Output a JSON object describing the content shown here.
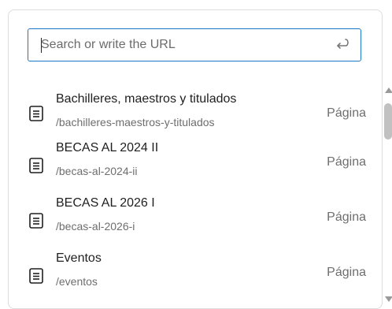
{
  "search": {
    "placeholder": "Search or write the URL",
    "value": ""
  },
  "results": [
    {
      "title": "Bachilleres, maestros y titulados",
      "slug": "/bachilleres-maestros-y-titulados",
      "type": "Página",
      "icon": "document-icon"
    },
    {
      "title": "BECAS AL 2024 II",
      "slug": "/becas-al-2024-ii",
      "type": "Página",
      "icon": "document-icon"
    },
    {
      "title": "BECAS AL 2026 I",
      "slug": "/becas-al-2026-i",
      "type": "Página",
      "icon": "document-icon"
    },
    {
      "title": "Eventos",
      "slug": "/eventos",
      "type": "Página",
      "icon": "document-icon"
    }
  ],
  "colors": {
    "focus_border": "#1b78c8",
    "text_primary": "#1f1f1f",
    "text_secondary": "#6e6e6e"
  }
}
